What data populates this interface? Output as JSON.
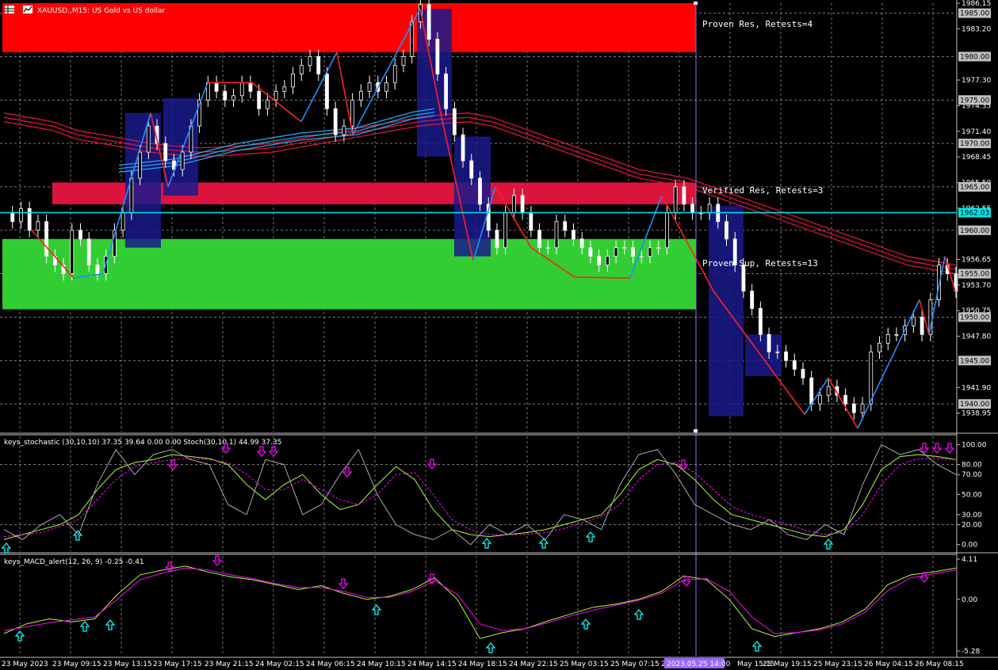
{
  "window": {
    "symbol_title": "XAUUSD.,M15: US Gold vs US dollar",
    "menu_icon": "grid-icon",
    "chart_icon": "chart-icon"
  },
  "chart_data": [
    {
      "type": "candlestick",
      "title": "XAUUSD.,M15: US Gold vs US dollar",
      "ylim": [
        1937.0,
        1986.15
      ],
      "price_ticks": [
        "1986.15",
        "1983.20",
        "1977.30",
        "1974.35",
        "1971.40",
        "1968.45",
        "1965.50",
        "1962.55",
        "1956.65",
        "1953.70",
        "1950.75",
        "1947.80",
        "1941.90",
        "1938.95"
      ],
      "price_labels": [
        {
          "text": "1985.00",
          "value": 1985.0
        },
        {
          "text": "1980.00",
          "value": 1980.0
        },
        {
          "text": "1975.00",
          "value": 1975.0
        },
        {
          "text": "1970.00",
          "value": 1970.0
        },
        {
          "text": "1965.00",
          "value": 1965.0
        },
        {
          "text": "1962.03",
          "value": 1962.03,
          "highlight": "#00e5e5"
        },
        {
          "text": "1960.00",
          "value": 1960.0
        },
        {
          "text": "1955.00",
          "value": 1955.0
        },
        {
          "text": "1950.00",
          "value": 1950.0
        },
        {
          "text": "1945.00",
          "value": 1945.0
        },
        {
          "text": "1940.00",
          "value": 1940.0
        }
      ],
      "zones": [
        {
          "label": "Proven Res, Retests=4",
          "top": 1986.15,
          "bottom": 1980.5,
          "color": "#ff0000"
        },
        {
          "label": "Verified Res, Retests=3",
          "top": 1965.5,
          "bottom": 1963.0,
          "color": "#dc143c"
        },
        {
          "label": "Proven Sup, Retests=13",
          "top": 1959.0,
          "bottom": 1950.9,
          "color": "#32cd32"
        }
      ],
      "current_price": 1962.03,
      "series": [
        {
          "name": "price",
          "color": "#ffffff",
          "values": [
            1962,
            1961,
            1962.5,
            1960,
            1961,
            1957,
            1956,
            1955,
            1960,
            1959,
            1956,
            1955,
            1957,
            1960,
            1962,
            1966,
            1969,
            1972,
            1970,
            1968,
            1967,
            1969,
            1972,
            1975,
            1977,
            1976,
            1975,
            1975.5,
            1977,
            1976,
            1974,
            1975,
            1976,
            1976.5,
            1978,
            1979,
            1980,
            1978,
            1974,
            1971,
            1972,
            1975,
            1976,
            1977,
            1976,
            1977,
            1979,
            1980,
            1984,
            1986,
            1982,
            1978,
            1974,
            1971,
            1968,
            1966,
            1963,
            1960,
            1958,
            1962,
            1964,
            1962,
            1960,
            1958,
            1958,
            1961,
            1960,
            1959,
            1958,
            1957,
            1956,
            1957,
            1958,
            1958,
            1957,
            1957,
            1958,
            1958,
            1962,
            1965,
            1963,
            1962,
            1962,
            1963,
            1961,
            1959,
            1956,
            1953,
            1951,
            1948,
            1946,
            1946,
            1945,
            1944,
            1943,
            1940,
            1941,
            1942,
            1941,
            1940,
            1939,
            1940,
            1946,
            1947,
            1948,
            1948,
            1949,
            1950,
            1948,
            1952,
            1956,
            1955,
            1953
          ]
        },
        {
          "name": "MA cluster",
          "color": "#dc143c",
          "values": [
            1972.5,
            1972,
            1971.5,
            1970.5,
            1970,
            1969.5,
            1969,
            1968.7,
            1968.5,
            1968.6,
            1968.8,
            1969,
            1969.5,
            1970,
            1970.5,
            1971,
            1971.5,
            1972,
            1972.3,
            1972.5,
            1972,
            1971,
            1970,
            1969,
            1968,
            1967,
            1966,
            1965.5,
            1965,
            1964,
            1963,
            1962,
            1961,
            1960,
            1959,
            1958,
            1957,
            1956,
            1955.5,
            1955
          ]
        }
      ]
    },
    {
      "type": "line",
      "title": "keys_stochastic (30,10,10) 37.35 39.64 0.00 0.00 Stoch(30,10,1) 44.99 37.35",
      "ylim": [
        -5,
        105
      ],
      "ticks": [
        "100.00",
        "80.00",
        "70.00",
        "50.00",
        "30.00",
        "20.00",
        "0.00"
      ],
      "series": [
        {
          "name": "main",
          "color": "#adff2f",
          "values": [
            5,
            10,
            15,
            20,
            30,
            55,
            75,
            82,
            85,
            90,
            88,
            86,
            80,
            60,
            45,
            60,
            70,
            50,
            35,
            40,
            60,
            78,
            65,
            35,
            15,
            10,
            8,
            10,
            12,
            15,
            20,
            25,
            30,
            50,
            75,
            85,
            80,
            65,
            45,
            30,
            25,
            20,
            15,
            10,
            8,
            15,
            40,
            75,
            88,
            90,
            88,
            85
          ]
        },
        {
          "name": "signal",
          "color": "#ff00ff",
          "values": [
            8,
            10,
            12,
            18,
            25,
            45,
            65,
            78,
            82,
            85,
            86,
            85,
            82,
            70,
            55,
            55,
            65,
            55,
            45,
            40,
            50,
            70,
            72,
            50,
            25,
            15,
            10,
            10,
            10,
            12,
            16,
            22,
            28,
            40,
            65,
            80,
            82,
            72,
            55,
            38,
            30,
            25,
            20,
            14,
            10,
            12,
            30,
            60,
            80,
            86,
            86,
            85
          ]
        },
        {
          "name": "raw",
          "color": "#a9a9a9",
          "values": [
            15,
            5,
            20,
            30,
            10,
            60,
            95,
            70,
            90,
            95,
            85,
            80,
            40,
            30,
            85,
            80,
            30,
            40,
            70,
            95,
            50,
            20,
            10,
            5,
            15,
            0,
            20,
            10,
            20,
            5,
            30,
            25,
            15,
            60,
            90,
            95,
            70,
            40,
            30,
            20,
            15,
            25,
            10,
            5,
            20,
            10,
            60,
            100,
            90,
            95,
            80,
            70
          ]
        }
      ]
    },
    {
      "type": "line",
      "title": "keys_MACD_alert(12, 26, 9) -0.25 -0.41",
      "ylim": [
        -5.28,
        4.11
      ],
      "ticks": [
        "4.11",
        "0.00",
        "-5.28"
      ],
      "series": [
        {
          "name": "MACD",
          "color": "#adff2f",
          "values": [
            -3.5,
            -2.5,
            -2,
            -2.3,
            -2,
            0.5,
            2.5,
            3,
            3.4,
            2.8,
            2.3,
            2,
            1.5,
            1,
            1.4,
            0.6,
            0,
            0.3,
            1,
            2.2,
            0,
            -4,
            -3.4,
            -3,
            -2.2,
            -1.5,
            -0.8,
            -0.5,
            0,
            0.8,
            2.4,
            2,
            0,
            -3,
            -3.8,
            -3.4,
            -3,
            -2.3,
            -1,
            1.5,
            2.5,
            2.8,
            3.2
          ]
        },
        {
          "name": "Signal",
          "color": "#ff00ff",
          "values": [
            -3.2,
            -2.8,
            -2.4,
            -2.1,
            -1.8,
            0,
            2,
            2.7,
            3.2,
            3,
            2.5,
            2.1,
            1.6,
            1.2,
            1.2,
            0.8,
            0.2,
            0.2,
            0.8,
            1.9,
            0.5,
            -2.5,
            -3.2,
            -3,
            -2.4,
            -1.7,
            -1.1,
            -0.6,
            -0.1,
            0.6,
            2,
            2.1,
            0.8,
            -1.8,
            -3.5,
            -3.4,
            -3.1,
            -2.5,
            -1.3,
            0.9,
            2.2,
            2.6,
            3
          ]
        }
      ]
    }
  ],
  "time_labels": [
    "23 May 2023",
    "23 May 09:15",
    "23 May 13:15",
    "23 May 17:15",
    "23 May 21:15",
    "24 May 02:15",
    "24 May 06:15",
    "24 May 10:15",
    "24 May 14:15",
    "24 May 18:15",
    "24 May 22:15",
    "25 May 03:15",
    "25 May 07:15",
    "2",
    "May 15:15",
    "25 May 19:15",
    "25 May 23:15",
    "26 May 04:15",
    "26 May 08:15"
  ],
  "crosshair_time": "2023.05.25 14:00",
  "colors": {
    "background": "#000000",
    "grid": "#c0c0c0",
    "up_trend": "#1e90ff",
    "down_trend": "#ff2020",
    "arrow_up": "#00ffff",
    "arrow_down": "#ff00ff",
    "box": "#1a1a8c",
    "crosshair": "#9966ff"
  }
}
